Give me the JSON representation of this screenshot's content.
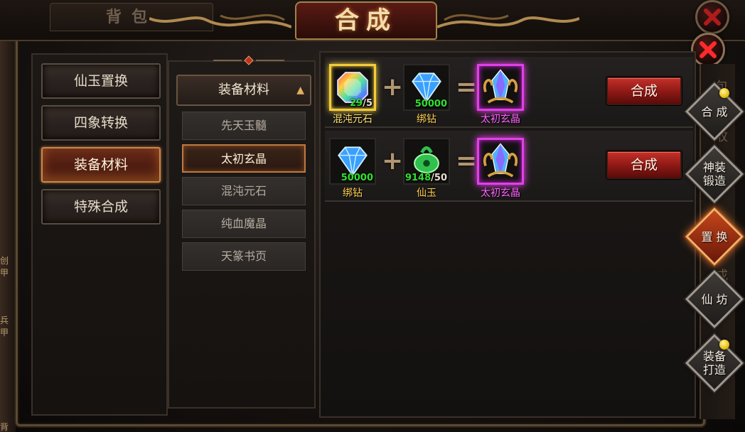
{
  "header": {
    "bag_tab": "背包",
    "title": "合成"
  },
  "categories": [
    {
      "label": "仙玉置换",
      "active": false
    },
    {
      "label": "四象转换",
      "active": false
    },
    {
      "label": "装备材料",
      "active": true
    },
    {
      "label": "特殊合成",
      "active": false
    }
  ],
  "sub_list": {
    "header": "装备材料",
    "items": [
      {
        "label": "先天玉髓",
        "active": false
      },
      {
        "label": "太初玄晶",
        "active": true
      },
      {
        "label": "混沌元石",
        "active": false
      },
      {
        "label": "纯血魔晶",
        "active": false
      },
      {
        "label": "天篆书页",
        "active": false
      }
    ]
  },
  "recipes": [
    {
      "ingredients": [
        {
          "name": "混沌元石",
          "icon": "chaos-stone-icon",
          "have": "29",
          "need": "/5",
          "name_color": "#ffe070",
          "frame": "gold"
        },
        {
          "name": "绑钻",
          "icon": "diamond-icon",
          "have": "50000",
          "need": "",
          "name_color": "#ffd050",
          "frame": "plain"
        }
      ],
      "result": {
        "name": "太初玄晶",
        "icon": "taichu-crystal-icon",
        "name_color": "#ff60ff"
      },
      "button": "合成"
    },
    {
      "ingredients": [
        {
          "name": "绑钻",
          "icon": "diamond-icon",
          "have": "50000",
          "need": "",
          "name_color": "#ffd050",
          "frame": "plain"
        },
        {
          "name": "仙玉",
          "icon": "jade-icon",
          "have": "9148",
          "need": "/50",
          "name_color": "#ffd050",
          "frame": "plain"
        }
      ],
      "result": {
        "name": "太初玄晶",
        "icon": "taichu-crystal-icon",
        "name_color": "#ff60ff"
      },
      "button": "合成"
    }
  ],
  "side_nav": [
    {
      "label": "合 成",
      "dot": true,
      "active": false
    },
    {
      "label": "神装\n锻造",
      "dot": false,
      "active": false
    },
    {
      "label": "置 换",
      "dot": false,
      "active": true
    },
    {
      "label": "仙 坊",
      "dot": false,
      "active": false
    },
    {
      "label": "装备\n打造",
      "dot": true,
      "active": false
    }
  ],
  "ghost_text": {
    "g1": "包",
    "g2": "收",
    "g3": "成"
  },
  "left_edge": {
    "e1": "创甲",
    "e2": "兵甲",
    "e3": "背"
  },
  "colors": {
    "have": "#30e030",
    "accent": "#c07840",
    "craft_button": "#a82420"
  }
}
